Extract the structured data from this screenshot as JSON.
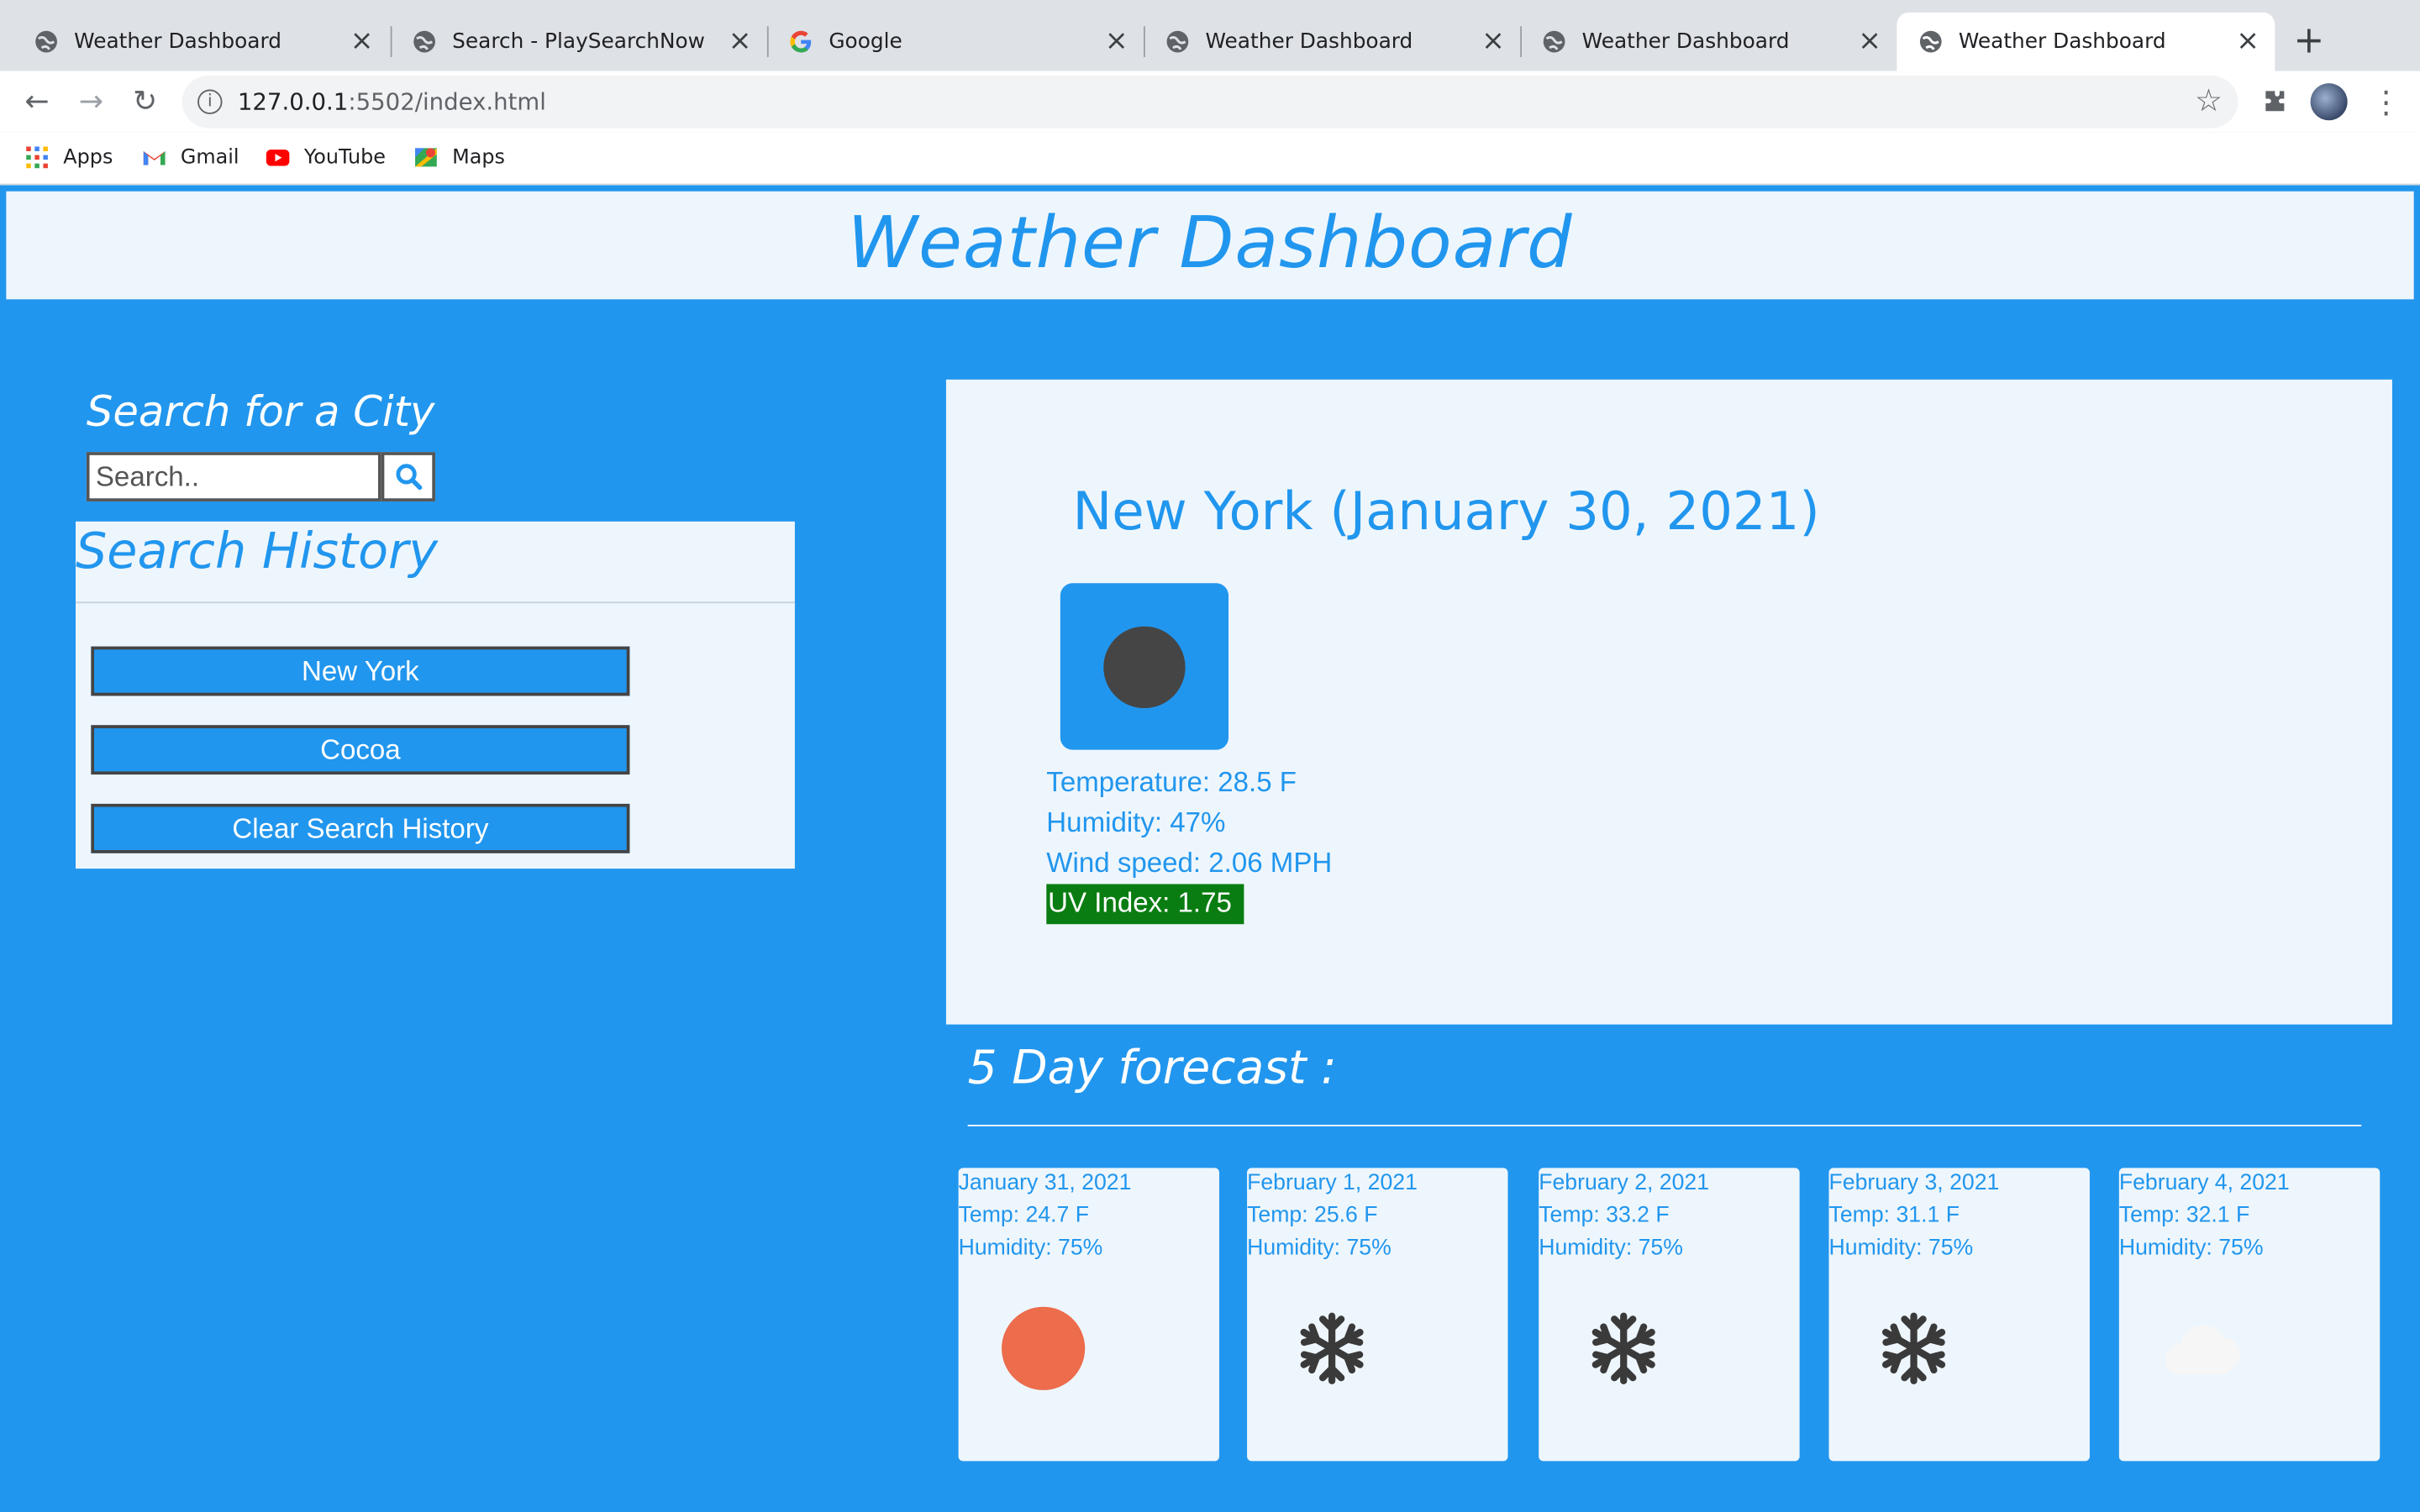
{
  "browser": {
    "tabs": [
      {
        "title": "Weather Dashboard",
        "icon": "globe-icon"
      },
      {
        "title": "Search - PlaySearchNow",
        "icon": "globe-icon"
      },
      {
        "title": "Google",
        "icon": "google-icon"
      },
      {
        "title": "Weather Dashboard",
        "icon": "globe-icon"
      },
      {
        "title": "Weather Dashboard",
        "icon": "globe-icon"
      },
      {
        "title": "Weather Dashboard",
        "icon": "globe-icon",
        "active": true
      }
    ],
    "url_host": "127.0.0.1",
    "url_rest": ":5502/index.html",
    "bookmarks": [
      {
        "label": "Apps",
        "icon": "apps-grid-icon"
      },
      {
        "label": "Gmail",
        "icon": "gmail-icon"
      },
      {
        "label": "YouTube",
        "icon": "youtube-icon"
      },
      {
        "label": "Maps",
        "icon": "maps-icon"
      }
    ]
  },
  "page": {
    "title": "Weather Dashboard",
    "search": {
      "heading": "Search for a City",
      "placeholder": "Search..",
      "button_icon": "search-icon"
    },
    "history": {
      "heading": "Search History",
      "items": [
        "New York",
        "Cocoa"
      ],
      "clear_label": "Clear Search History"
    },
    "current": {
      "heading": "New York (January 30, 2021)",
      "icon": "dark-circle-icon",
      "temperature": "Temperature: 28.5 F",
      "humidity": "Humidity: 47%",
      "wind": "Wind speed: 2.06 MPH",
      "uv": "UV Index: 1.75"
    },
    "forecast": {
      "heading": "5 Day forecast :",
      "days": [
        {
          "date": "January 31, 2021",
          "temp": "Temp: 24.7 F",
          "humidity": "Humidity: 75%",
          "icon": "sun-icon"
        },
        {
          "date": "February 1, 2021",
          "temp": "Temp: 25.6 F",
          "humidity": "Humidity: 75%",
          "icon": "snowflake-icon"
        },
        {
          "date": "February 2, 2021",
          "temp": "Temp: 33.2 F",
          "humidity": "Humidity: 75%",
          "icon": "snowflake-icon"
        },
        {
          "date": "February 3, 2021",
          "temp": "Temp: 31.1 F",
          "humidity": "Humidity: 75%",
          "icon": "snowflake-icon"
        },
        {
          "date": "February 4, 2021",
          "temp": "Temp: 32.1 F",
          "humidity": "Humidity: 75%",
          "icon": "cloud-icon"
        }
      ]
    }
  },
  "colors": {
    "page_bg": "#2196ee",
    "card_bg": "#eef6fd",
    "accent": "#2196ee",
    "uv_badge": "#0a7d12",
    "sun": "#ec6c4c",
    "snowflake": "#3a3a3a"
  }
}
